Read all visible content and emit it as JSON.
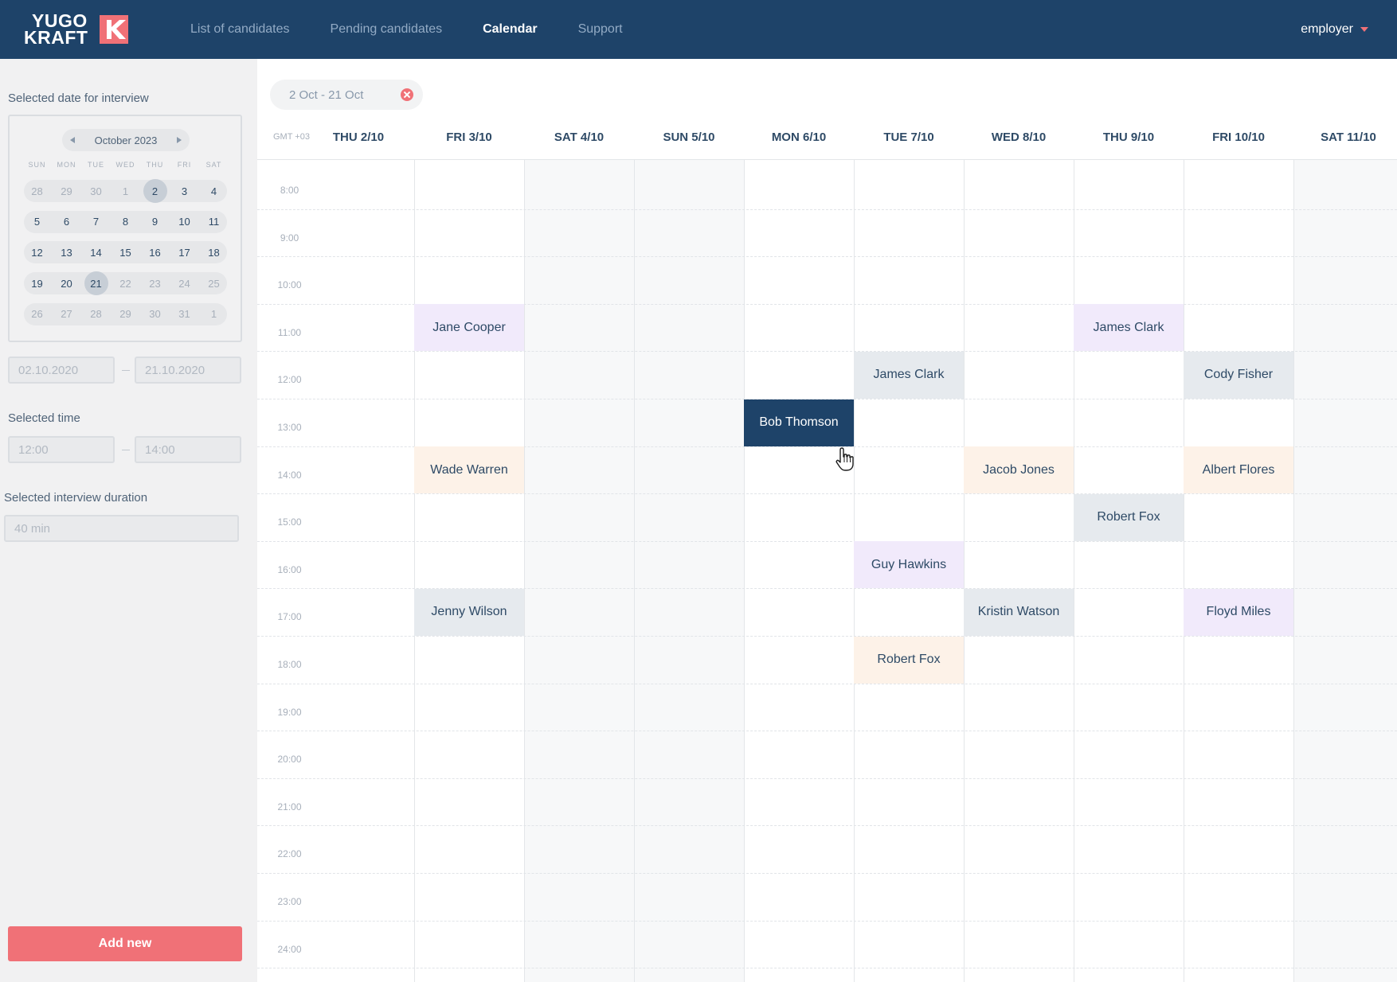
{
  "app": {
    "logo_text_line1": "YUGO",
    "logo_text_line2": "KRAFT",
    "brand_color": "#1e4369",
    "accent_color": "#f07177"
  },
  "nav": {
    "items": [
      {
        "label": "List of candidates",
        "active": false
      },
      {
        "label": "Pending candidates",
        "active": false
      },
      {
        "label": "Calendar",
        "active": true
      },
      {
        "label": "Support",
        "active": false
      }
    ],
    "user_label": "employer"
  },
  "sidebar": {
    "date_label": "Selected date for interview",
    "mini_calendar": {
      "month_label": "October 2023",
      "weekdays": [
        "SUN",
        "MON",
        "TUE",
        "WED",
        "THU",
        "FRI",
        "SAT"
      ],
      "weeks": [
        [
          "28",
          "29",
          "30",
          "1",
          "2",
          "3",
          "4"
        ],
        [
          "5",
          "6",
          "7",
          "8",
          "9",
          "10",
          "11"
        ],
        [
          "12",
          "13",
          "14",
          "15",
          "16",
          "17",
          "18"
        ],
        [
          "19",
          "20",
          "21",
          "22",
          "23",
          "24",
          "25"
        ],
        [
          "26",
          "27",
          "28",
          "29",
          "30",
          "31",
          "1"
        ]
      ],
      "selected_start": "2",
      "selected_end": "21"
    },
    "date_from": "02.10.2020",
    "date_to": "21.10.2020",
    "time_label": "Selected time",
    "time_from": "12:00",
    "time_to": "14:00",
    "duration_label": "Selected interview duration",
    "duration_value": "40 min",
    "add_button": "Add new"
  },
  "main": {
    "range_chip": "2 Oct - 21 Oct",
    "timezone": "GMT +03",
    "day_columns": [
      "THU 2/10",
      "FRI 3/10",
      "SAT 4/10",
      "SUN 5/10",
      "MON 6/10",
      "TUE 7/10",
      "WED 8/10",
      "THU 9/10",
      "FRI 10/10",
      "SAT 11/10"
    ],
    "time_slots": [
      "8:00",
      "9:00",
      "10:00",
      "11:00",
      "12:00",
      "13:00",
      "14:00",
      "15:00",
      "16:00",
      "17:00",
      "18:00",
      "19:00",
      "20:00",
      "21:00",
      "22:00",
      "23:00",
      "24:00"
    ],
    "events": [
      {
        "name": "Jane Cooper",
        "day": "FRI 3/10",
        "time": "11:00",
        "color": "purple"
      },
      {
        "name": "Wade Warren",
        "day": "FRI 3/10",
        "time": "14:00",
        "color": "orange"
      },
      {
        "name": "Jenny Wilson",
        "day": "FRI 3/10",
        "time": "17:00",
        "color": "gray"
      },
      {
        "name": "Bob Thomson",
        "day": "MON 6/10",
        "time": "13:00",
        "color": "navy"
      },
      {
        "name": "James Clark",
        "day": "TUE 7/10",
        "time": "12:00",
        "color": "gray"
      },
      {
        "name": "Guy Hawkins",
        "day": "TUE 7/10",
        "time": "16:00",
        "color": "purple"
      },
      {
        "name": "Robert Fox",
        "day": "TUE 7/10",
        "time": "18:00",
        "color": "orange"
      },
      {
        "name": "Jacob Jones",
        "day": "WED 8/10",
        "time": "14:00",
        "color": "orange"
      },
      {
        "name": "Kristin Watson",
        "day": "WED 8/10",
        "time": "17:00",
        "color": "gray"
      },
      {
        "name": "James Clark",
        "day": "THU 9/10",
        "time": "11:00",
        "color": "purple"
      },
      {
        "name": "Robert Fox",
        "day": "THU 9/10",
        "time": "15:00",
        "color": "gray"
      },
      {
        "name": "Cody Fisher",
        "day": "FRI 10/10",
        "time": "12:00",
        "color": "gray"
      },
      {
        "name": "Albert Flores",
        "day": "FRI 10/10",
        "time": "14:00",
        "color": "orange"
      },
      {
        "name": "Floyd Miles",
        "day": "FRI 10/10",
        "time": "17:00",
        "color": "purple"
      }
    ]
  }
}
